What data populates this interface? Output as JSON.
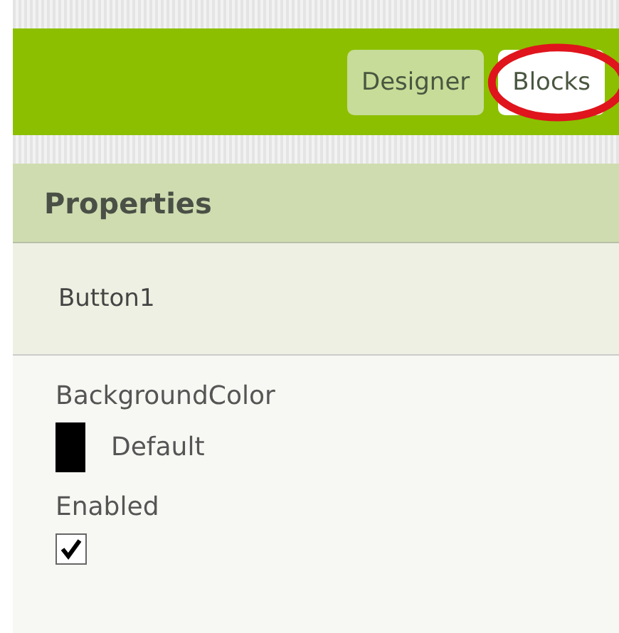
{
  "toolbar": {
    "buttons": [
      {
        "label": "Designer",
        "selected": true,
        "circled": false
      },
      {
        "label": "Blocks",
        "selected": false,
        "circled": true
      }
    ]
  },
  "properties": {
    "title": "Properties",
    "component": "Button1",
    "items": [
      {
        "kind": "color",
        "label": "BackgroundColor",
        "value": "Default",
        "color": "#000000"
      },
      {
        "kind": "checkbox",
        "label": "Enabled",
        "checked": true
      }
    ]
  }
}
